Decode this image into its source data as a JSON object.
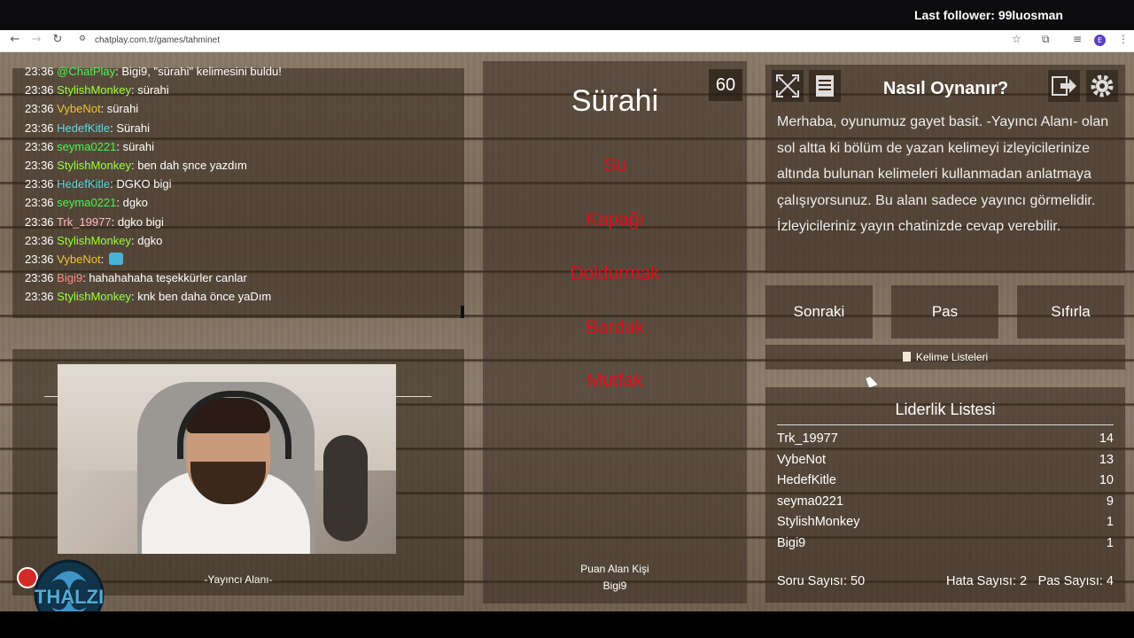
{
  "overlay": {
    "follower_text": "Last follower: 99luosman"
  },
  "browser": {
    "url": "chatplay.com.tr/games/tahminet",
    "profile_initial": "E"
  },
  "chat": {
    "messages": [
      {
        "time": "23:36",
        "user": "@ChatPlay",
        "user_color": "#4ff24f",
        "text": ": Bigi9, \"sürahi\" kelimesini buldu!"
      },
      {
        "time": "23:36",
        "user": "StylishMonkey",
        "user_color": "#9aff3a",
        "text": ": sürahi"
      },
      {
        "time": "23:36",
        "user": "VybeNot",
        "user_color": "#f2c23a",
        "text": ": sürahi"
      },
      {
        "time": "23:36",
        "user": "HedefKitle",
        "user_color": "#5fd8e8",
        "text": ": Sürahi"
      },
      {
        "time": "23:36",
        "user": "seyma0221",
        "user_color": "#4ff24f",
        "text": ": sürahi"
      },
      {
        "time": "23:36",
        "user": "StylishMonkey",
        "user_color": "#9aff3a",
        "text": ": ben dah şnce yazdım"
      },
      {
        "time": "23:36",
        "user": "HedefKitle",
        "user_color": "#5fd8e8",
        "text": ": DGKO bigi"
      },
      {
        "time": "23:36",
        "user": "seyma0221",
        "user_color": "#4ff24f",
        "text": ": dgko"
      },
      {
        "time": "23:36",
        "user": "Trk_19977",
        "user_color": "#ffb6c8",
        "text": ": dgko bigi"
      },
      {
        "time": "23:36",
        "user": "StylishMonkey",
        "user_color": "#9aff3a",
        "text": ": dgko"
      },
      {
        "time": "23:36",
        "user": "VybeNot",
        "user_color": "#f2c23a",
        "text": ": "
      },
      {
        "time": "23:36",
        "user": "Bigi9",
        "user_color": "#ff8a80",
        "text": ": hahahahaha teşekkürler canlar"
      },
      {
        "time": "23:36",
        "user": "StylishMonkey",
        "user_color": "#9aff3a",
        "text": ": knk ben daha önce yaDım"
      }
    ]
  },
  "streamer_area": {
    "caption": "-Yayıncı Alanı-",
    "logo_text": "THALZI"
  },
  "game": {
    "timer": "60",
    "main_word": "Sürahi",
    "taboo_words": [
      "Su",
      "Kapağı",
      "Doldurmak",
      "Bardak",
      "Mutfak"
    ],
    "scorer_label": "Puan Alan Kişi",
    "scorer_name": "Bigi9"
  },
  "help": {
    "title": "Nasıl Oynanır?",
    "text": "Merhaba, oyunumuz gayet basit. -Yayıncı Alanı- olan sol altta ki bölüm de yazan kelimeyi izleyicilerinize altında bulunan kelimeleri kullanmadan anlatmaya çalışıyorsunuz. Bu alanı sadece yayıncı görmelidir. İzleyicileriniz yayın chatinizde cevap verebilir."
  },
  "controls": {
    "next": "Sonraki",
    "pass": "Pas",
    "reset": "Sıfırla",
    "word_lists": "Kelime Listeleri"
  },
  "leaderboard": {
    "title": "Liderlik Listesi",
    "rows": [
      {
        "name": "Trk_19977",
        "score": "14"
      },
      {
        "name": "VybeNot",
        "score": "13"
      },
      {
        "name": "HedefKitle",
        "score": "10"
      },
      {
        "name": "seyma0221",
        "score": "9"
      },
      {
        "name": "StylishMonkey",
        "score": "1"
      },
      {
        "name": "Bigi9",
        "score": "1"
      }
    ],
    "question_count": "Soru Sayısı: 50",
    "error_count": "Hata Sayısı: 2",
    "pass_count": "Pas Sayısı: 4"
  }
}
